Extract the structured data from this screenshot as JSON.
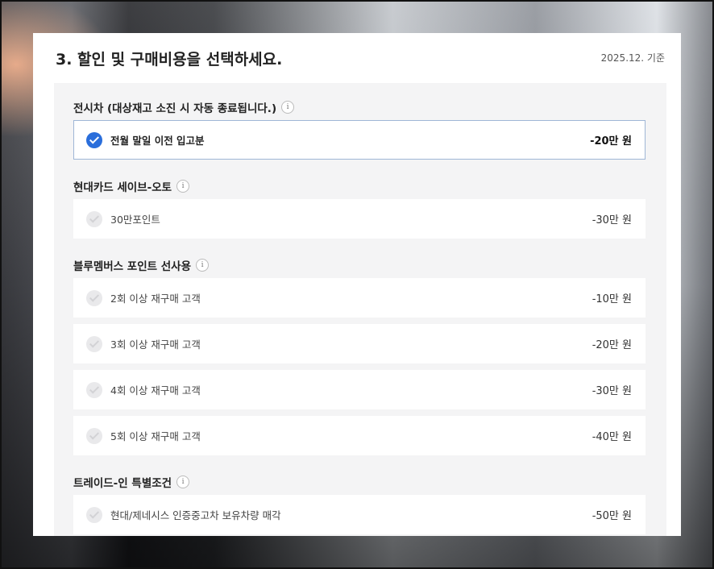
{
  "title": "3. 할인 및 구매비용을 선택하세요.",
  "date_note": "2025.12. 기준",
  "sections": [
    {
      "title": "전시차 (대상재고 소진 시 자동 종료됩니다.)",
      "options": [
        {
          "label": "전월 말일 이전 입고분",
          "price": "-20만 원",
          "selected": true
        }
      ]
    },
    {
      "title": "현대카드 세이브-오토",
      "options": [
        {
          "label": "30만포인트",
          "price": "-30만 원",
          "selected": false
        }
      ]
    },
    {
      "title": "블루멤버스 포인트 선사용",
      "options": [
        {
          "label": "2회 이상 재구매 고객",
          "price": "-10만 원",
          "selected": false
        },
        {
          "label": "3회 이상 재구매 고객",
          "price": "-20만 원",
          "selected": false
        },
        {
          "label": "4회 이상 재구매 고객",
          "price": "-30만 원",
          "selected": false
        },
        {
          "label": "5회 이상 재구매 고객",
          "price": "-40만 원",
          "selected": false
        }
      ]
    },
    {
      "title": "트레이드-인 특별조건",
      "options": [
        {
          "label": "현대/제네시스 인증중고차 보유차량 매각",
          "price": "-50만 원",
          "selected": false
        }
      ]
    }
  ],
  "info_glyph": "i",
  "colors": {
    "accent": "#2a6edb",
    "selected_border": "#9fb6d6",
    "panel_bg": "#f4f4f5"
  }
}
